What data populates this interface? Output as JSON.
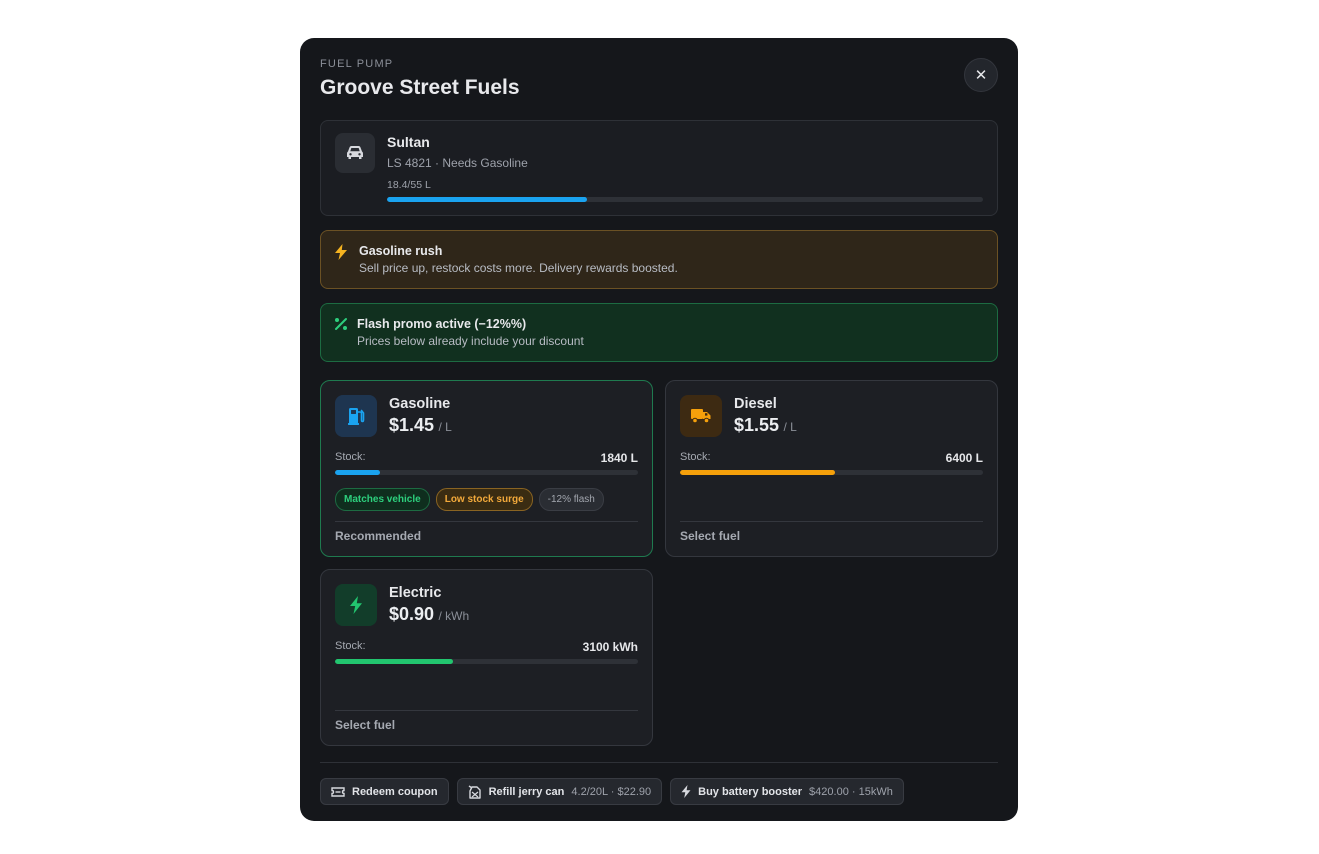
{
  "header": {
    "eyebrow": "FUEL PUMP",
    "title": "Groove Street Fuels",
    "close_icon": "close-icon",
    "close_glyph": "✕"
  },
  "vehicle": {
    "icon": "car-icon",
    "name": "Sultan",
    "subtitle": "LS 4821 · Needs Gasoline",
    "level_text": "18.4/55 L",
    "fuel_fraction": 0.335,
    "bar_color": "#1aa3f0"
  },
  "alerts": {
    "rush": {
      "icon": "lightning-icon",
      "title": "Gasoline rush",
      "body": "Sell price up, restock costs more. Delivery rewards boosted.",
      "color": "#f2a93b"
    },
    "promo": {
      "icon": "percent-icon",
      "title": "Flash promo active (−12%%)",
      "body": "Prices below already include your discount",
      "color": "#2dcf7d"
    }
  },
  "fuels": [
    {
      "name": "Gasoline",
      "price": "$1.45",
      "unit": "/ L",
      "stock_label": "Stock:",
      "stock_value": "1840 L",
      "stock_fraction": 0.15,
      "bar_color": "#1aa3f0",
      "icon": "gas-pump-icon",
      "tags": [
        "Matches vehicle",
        "Low stock surge",
        "-12% flash"
      ],
      "footer": "Recommended"
    },
    {
      "name": "Diesel",
      "price": "$1.55",
      "unit": "/ L",
      "stock_label": "Stock:",
      "stock_value": "6400 L",
      "stock_fraction": 0.51,
      "bar_color": "#f5a00b",
      "icon": "truck-icon",
      "footer": "Select fuel"
    },
    {
      "name": "Electric",
      "price": "$0.90",
      "unit": "/ kWh",
      "stock_label": "Stock:",
      "stock_value": "3100 kWh",
      "stock_fraction": 0.39,
      "bar_color": "#22c56f",
      "icon": "lightning-icon",
      "footer": "Select fuel"
    }
  ],
  "actions": [
    {
      "icon": "ticket-icon",
      "label": "Redeem coupon",
      "meta": ""
    },
    {
      "icon": "jerry-can-icon",
      "label": "Refill jerry can",
      "meta": "4.2/20L · $22.90"
    },
    {
      "icon": "lightning-icon",
      "label": "Buy battery booster",
      "meta": "$420.00 · 15kWh"
    }
  ]
}
